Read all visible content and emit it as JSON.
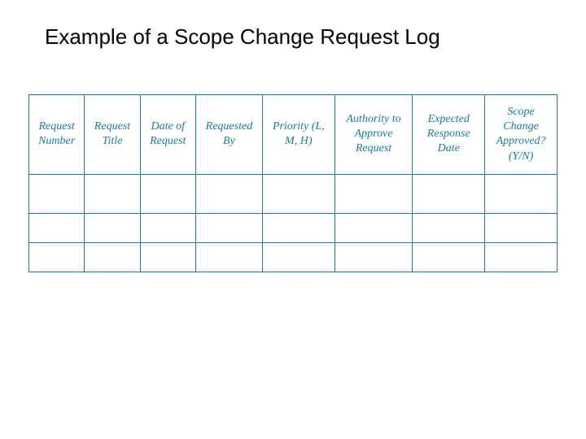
{
  "title": "Example of a Scope Change Request Log",
  "headers": [
    "Request Number",
    "Request Title",
    "Date of Request",
    "Requested By",
    "Priority (L, M, H)",
    "Authority to Approve Request",
    "Expected Response Date",
    "Scope Change Approved? (Y/N)"
  ],
  "rows": [
    [
      "",
      "",
      "",
      "",
      "",
      "",
      "",
      ""
    ],
    [
      "",
      "",
      "",
      "",
      "",
      "",
      "",
      ""
    ],
    [
      "",
      "",
      "",
      "",
      "",
      "",
      "",
      ""
    ]
  ]
}
